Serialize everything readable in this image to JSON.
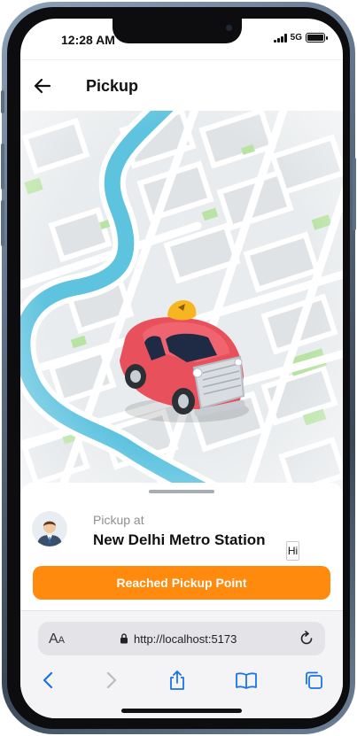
{
  "status_bar": {
    "time": "12:28 AM",
    "network": "5G"
  },
  "header": {
    "title": "Pickup"
  },
  "pickup": {
    "label": "Pickup at",
    "location": "New Delhi Metro Station",
    "hi_label": "Hi",
    "action_label": "Reached Pickup Point"
  },
  "browser": {
    "text_size_label_large": "A",
    "text_size_label_small": "A",
    "url": "http://localhost:5173"
  },
  "colors": {
    "accent": "#ff8a0d",
    "ios_blue": "#1a73e8",
    "river": "#5ec3df",
    "park": "#b8e3a3"
  },
  "icons": {
    "back": "arrow-left-icon",
    "lock": "lock-icon",
    "reload": "reload-icon",
    "toolbar": [
      "chevron-left-icon",
      "chevron-right-icon",
      "share-icon",
      "book-icon",
      "tabs-icon"
    ]
  }
}
